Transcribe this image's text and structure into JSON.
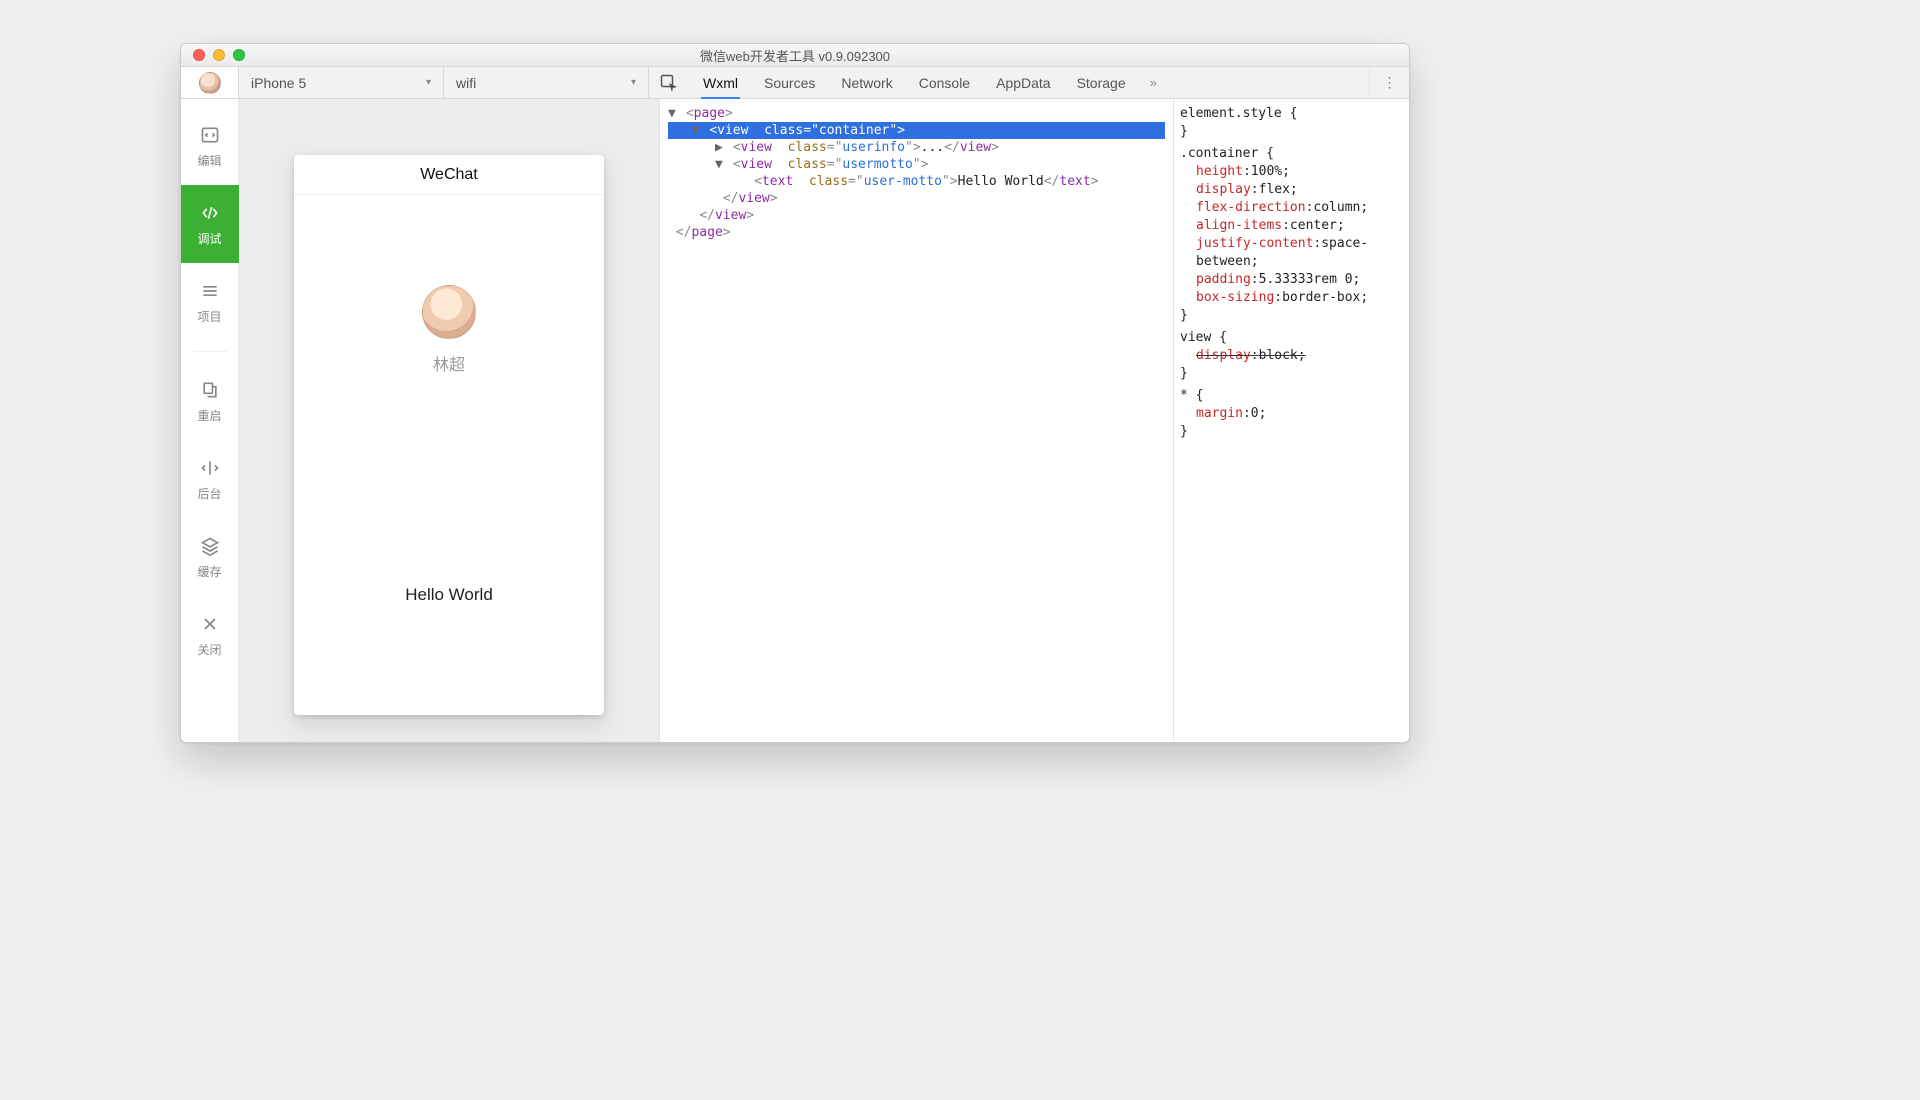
{
  "window": {
    "title": "微信web开发者工具 v0.9.092300"
  },
  "toolbar": {
    "deviceSelector": "iPhone 5",
    "networkSelector": "wifi",
    "devtoolsTabs": [
      "Wxml",
      "Sources",
      "Network",
      "Console",
      "AppData",
      "Storage"
    ],
    "activeDevtoolTab": "Wxml",
    "moreGlyph": "»",
    "kebabGlyph": "⋮"
  },
  "sidebar": {
    "items": [
      {
        "id": "edit",
        "label": "编辑"
      },
      {
        "id": "debug",
        "label": "调试"
      },
      {
        "id": "project",
        "label": "项目"
      },
      {
        "id": "restart",
        "label": "重启"
      },
      {
        "id": "background",
        "label": "后台"
      },
      {
        "id": "cache",
        "label": "缓存"
      },
      {
        "id": "close",
        "label": "关闭"
      }
    ],
    "activeId": "debug"
  },
  "simulator": {
    "navTitle": "WeChat",
    "nickname": "林超",
    "motto": "Hello World"
  },
  "wxml": {
    "pageOpen": "page",
    "container": {
      "tag": "view",
      "attrName": "class",
      "attrValue": "container"
    },
    "userinfo": {
      "tag": "view",
      "attrName": "class",
      "attrValue": "userinfo",
      "ellipsis": "..."
    },
    "usermotto": {
      "tag": "view",
      "attrName": "class",
      "attrValue": "usermotto"
    },
    "text": {
      "tag": "text",
      "attrName": "class",
      "attrValue": "user-motto",
      "text": "Hello World"
    }
  },
  "styles": {
    "rules": [
      {
        "selector": "element.style {",
        "decls": [],
        "close": "}"
      },
      {
        "selector": ".container {",
        "decls": [
          {
            "prop": "height",
            "val": "100%;"
          },
          {
            "prop": "display",
            "val": "flex;"
          },
          {
            "prop": "flex-direction",
            "val": "column;"
          },
          {
            "prop": "align-items",
            "val": "center;"
          },
          {
            "prop": "justify-content",
            "val": "space-between;"
          },
          {
            "prop": "padding",
            "val": "5.33333rem 0;"
          },
          {
            "prop": "box-sizing",
            "val": "border-box;"
          }
        ],
        "close": "}"
      },
      {
        "selector": "view {",
        "decls": [
          {
            "prop": "display",
            "val": "block;",
            "strike": true
          }
        ],
        "close": "}"
      },
      {
        "selector": "* {",
        "decls": [
          {
            "prop": "margin",
            "val": "0;"
          }
        ],
        "close": "}"
      }
    ]
  }
}
